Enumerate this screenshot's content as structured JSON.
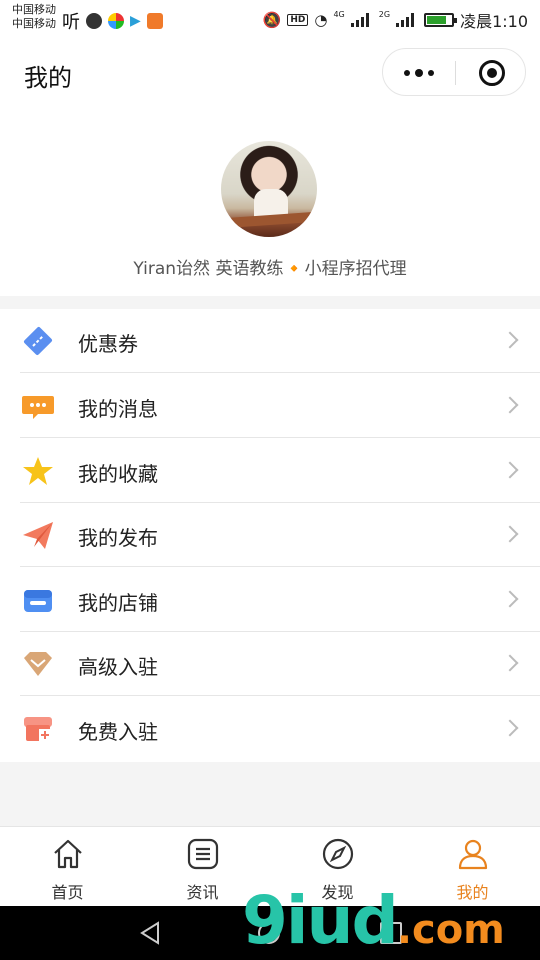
{
  "status_bar": {
    "carrier1": "中国移动",
    "carrier2": "中国移动",
    "app_glyph": "听",
    "hd": "HD",
    "net1": "4G",
    "net2": "2G",
    "time": "凌晨1:10"
  },
  "header": {
    "title": "我的"
  },
  "profile": {
    "name": "Yiran诒然 英语教练🔸小程序招代理"
  },
  "menu": {
    "items": [
      {
        "label": "优惠券",
        "icon": "coupon-icon",
        "color": "#5b8ff0"
      },
      {
        "label": "我的消息",
        "icon": "message-icon",
        "color": "#f79a2a"
      },
      {
        "label": "我的收藏",
        "icon": "star-icon",
        "color": "#f7c31a"
      },
      {
        "label": "我的发布",
        "icon": "paper-plane-icon",
        "color": "#f27a5e"
      },
      {
        "label": "我的店铺",
        "icon": "shop-icon",
        "color": "#4f8ff2"
      },
      {
        "label": "高级入驻",
        "icon": "diamond-icon",
        "color": "#d9a676"
      },
      {
        "label": "免费入驻",
        "icon": "store-plus-icon",
        "color": "#f2755f"
      }
    ]
  },
  "tabbar": {
    "tabs": [
      {
        "label": "首页",
        "icon": "home-icon"
      },
      {
        "label": "资讯",
        "icon": "list-icon"
      },
      {
        "label": "发现",
        "icon": "compass-icon"
      },
      {
        "label": "我的",
        "icon": "user-icon",
        "active": true
      }
    ],
    "active_color": "#e8831f"
  },
  "watermark": {
    "part1": "9iud",
    "part2": ".com"
  }
}
